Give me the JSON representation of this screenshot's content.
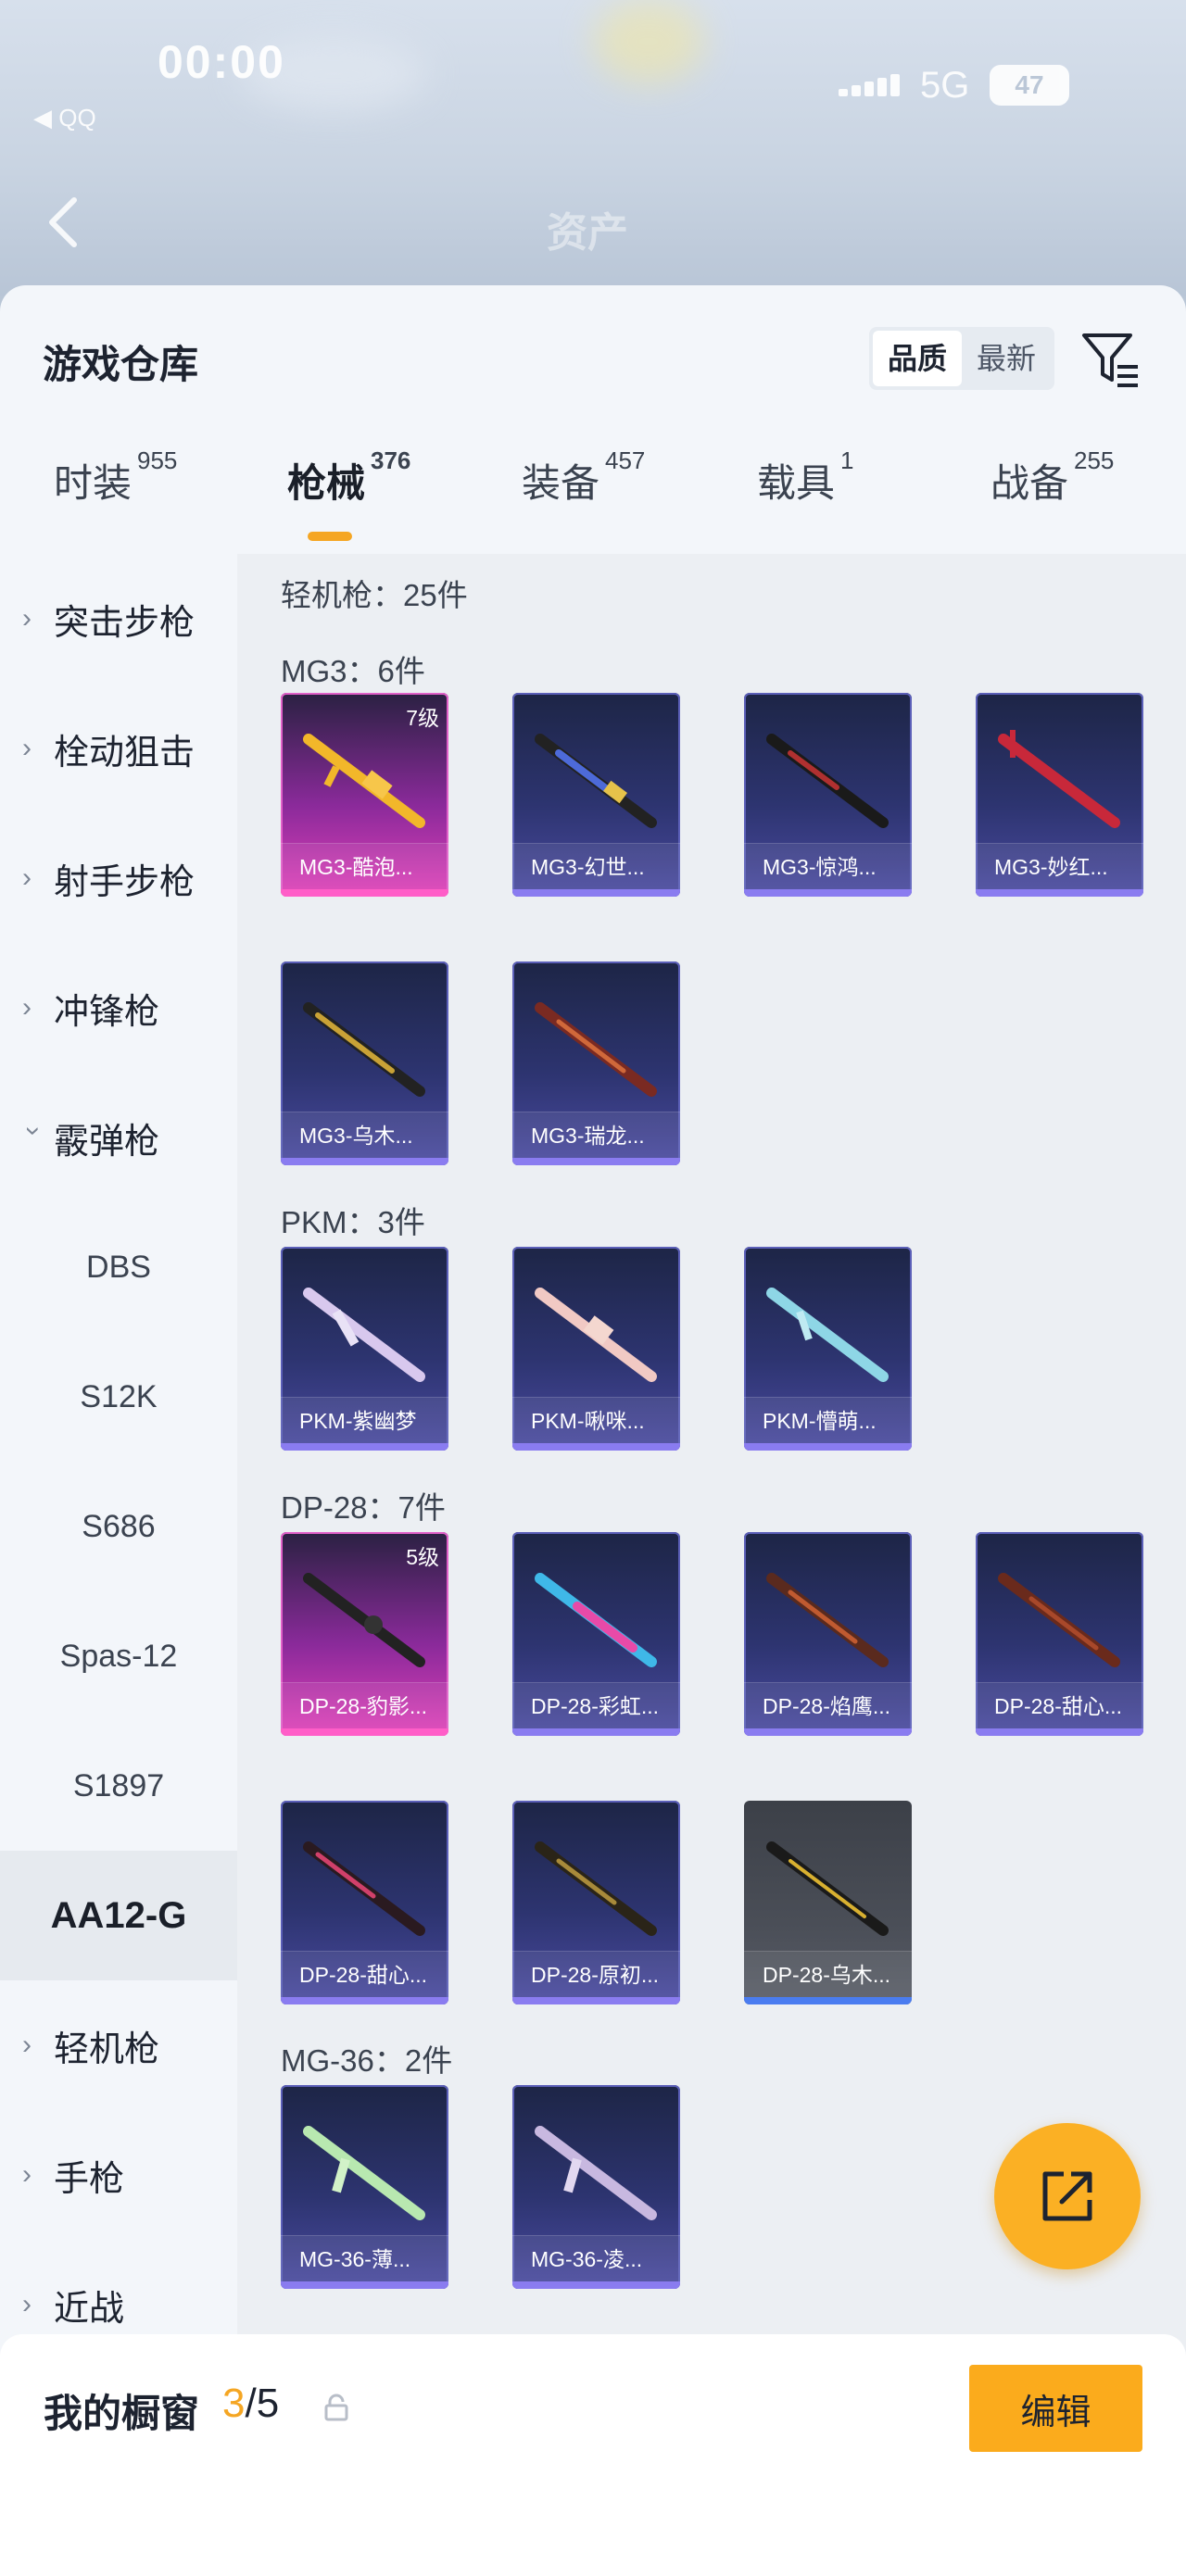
{
  "status_bar": {
    "time": "00:00",
    "back_app": "◀ QQ",
    "network": "5G",
    "battery": "47"
  },
  "background": {
    "title": "资产"
  },
  "header": {
    "title": "游戏仓库",
    "sort_options": [
      "品质",
      "最新"
    ],
    "active_sort": "品质",
    "filter_icon": "filter-icon"
  },
  "tabs": [
    {
      "label": "时装",
      "count": "955"
    },
    {
      "label": "枪械",
      "count": "376"
    },
    {
      "label": "装备",
      "count": "457"
    },
    {
      "label": "载具",
      "count": "1"
    },
    {
      "label": "战备",
      "count": "255"
    }
  ],
  "active_tab": "枪械",
  "sidebar": {
    "items": [
      {
        "label": "突击步枪",
        "type": "collapsed"
      },
      {
        "label": "栓动狙击",
        "type": "collapsed"
      },
      {
        "label": "射手步枪",
        "type": "collapsed"
      },
      {
        "label": "冲锋枪",
        "type": "collapsed"
      },
      {
        "label": "霰弹枪",
        "type": "expanded"
      },
      {
        "label": "DBS",
        "type": "sub"
      },
      {
        "label": "S12K",
        "type": "sub"
      },
      {
        "label": "S686",
        "type": "sub"
      },
      {
        "label": "Spas-12",
        "type": "sub"
      },
      {
        "label": "S1897",
        "type": "sub"
      },
      {
        "label": "AA12-G",
        "type": "selected"
      },
      {
        "label": "轻机枪",
        "type": "collapsed"
      },
      {
        "label": "手枪",
        "type": "collapsed"
      },
      {
        "label": "近战",
        "type": "collapsed"
      }
    ]
  },
  "content": {
    "category_header": "轻机枪：25件",
    "sections": [
      {
        "label": "MG3：6件",
        "items": [
          {
            "name": "MG3-酷泡...",
            "level": "7级",
            "rarity": "pink"
          },
          {
            "name": "MG3-幻世...",
            "rarity": "purple"
          },
          {
            "name": "MG3-惊鸿...",
            "rarity": "purple"
          },
          {
            "name": "MG3-妙红...",
            "rarity": "purple"
          },
          {
            "name": "MG3-乌木...",
            "rarity": "purple"
          },
          {
            "name": "MG3-瑞龙...",
            "rarity": "purple"
          }
        ]
      },
      {
        "label": "PKM：3件",
        "items": [
          {
            "name": "PKM-紫幽梦",
            "rarity": "purple"
          },
          {
            "name": "PKM-啾咪...",
            "rarity": "purple"
          },
          {
            "name": "PKM-懵萌...",
            "rarity": "purple"
          }
        ]
      },
      {
        "label": "DP-28：7件",
        "items": [
          {
            "name": "DP-28-豹影...",
            "level": "5级",
            "rarity": "pink"
          },
          {
            "name": "DP-28-彩虹...",
            "rarity": "purple"
          },
          {
            "name": "DP-28-焰鹰...",
            "rarity": "purple"
          },
          {
            "name": "DP-28-甜心...",
            "rarity": "purple"
          },
          {
            "name": "DP-28-甜心...",
            "rarity": "purple"
          },
          {
            "name": "DP-28-原初...",
            "rarity": "purple"
          },
          {
            "name": "DP-28-乌木...",
            "rarity": "gray"
          }
        ]
      },
      {
        "label": "MG-36：2件",
        "items": [
          {
            "name": "MG-36-薄...",
            "rarity": "purple"
          },
          {
            "name": "MG-36-凌...",
            "rarity": "purple"
          }
        ]
      }
    ]
  },
  "fab": {
    "icon": "share-icon"
  },
  "showcase": {
    "title": "我的橱窗",
    "current": "3",
    "total": "/5",
    "edit_label": "编辑"
  },
  "colors": {
    "accent": "#f5a623",
    "purple_card": "#2d3470",
    "pink_card": "#e040b8",
    "gray_card": "#4a4e57"
  }
}
